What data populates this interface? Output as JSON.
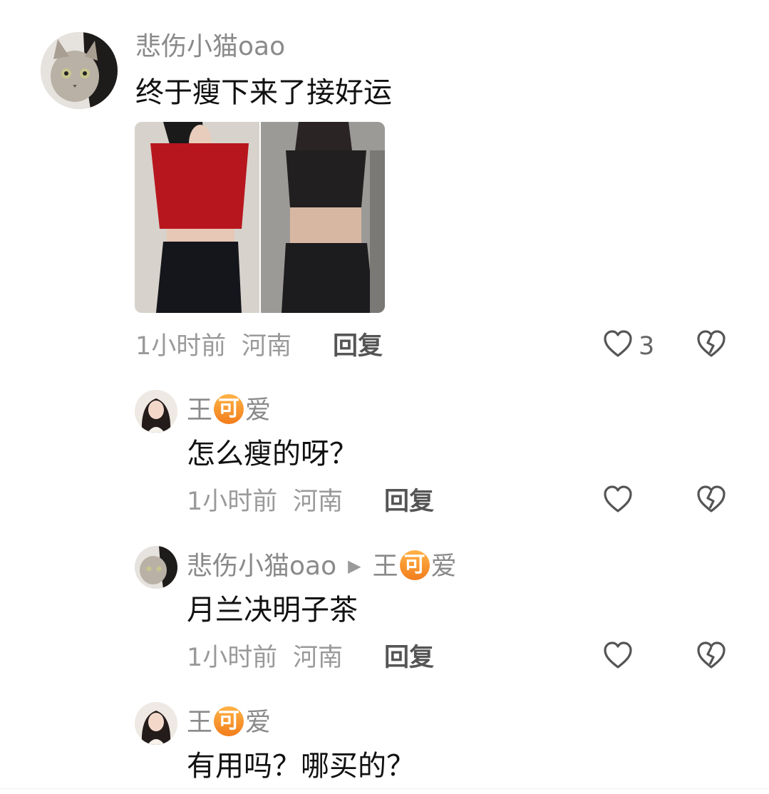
{
  "comments": [
    {
      "author": "悲伤小猫oao",
      "text": "终于瘦下来了接好运",
      "time": "1小时前",
      "location": "河南",
      "reply_label": "回复",
      "likes": "3",
      "has_image": true
    }
  ],
  "replies": [
    {
      "author_a": "王",
      "badge": "可",
      "author_b": "爱",
      "text": "怎么瘦的呀？",
      "time": "1小时前",
      "location": "河南",
      "reply_label": "回复"
    },
    {
      "author": "悲伤小猫oao",
      "reply_to_a": "王",
      "reply_to_badge": "可",
      "reply_to_b": "爱",
      "text": "月兰决明子茶",
      "time": "1小时前",
      "location": "河南",
      "reply_label": "回复"
    },
    {
      "author_a": "王",
      "badge": "可",
      "author_b": "爱",
      "text": "有用吗？哪买的？"
    }
  ],
  "colors": {
    "badge": "#f27d1b",
    "meta": "#9a9a9a",
    "name": "#8a8a8a"
  }
}
